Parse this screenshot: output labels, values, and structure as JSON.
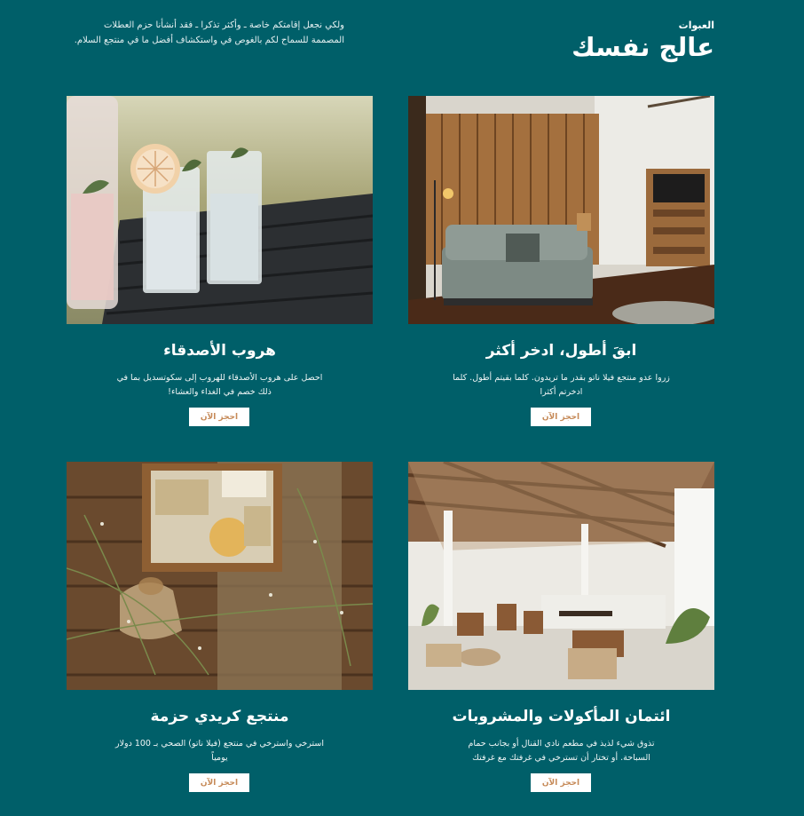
{
  "header": {
    "eyebrow": "العبوات",
    "title": "عالج نفسك",
    "description": "ولكي نجعل إقامتكم خاصة ـ وأكثر تذكرا ـ فقد أنشأنا حزم العطلات المصممة للسماح لكم بالغوص في واستكشاف أفضل ما في منتجع السلام."
  },
  "cards": [
    {
      "title": "ابقَ أطول، ادخر أكثر",
      "description": "زروا عدو منتجع فيلا ناتو بقدر ما تريدون. كلما بقيتم أطول. كلما ادخرتم أكثرا",
      "button": "احجز الآن",
      "image": "living-room-photo"
    },
    {
      "title": "هروب الأصدقاء",
      "description": "احصل على هروب الأصدقاء للهروب إلى سكوتسديل بما في ذلك خصم في الغداء والعشاء!",
      "button": "احجز الآن",
      "image": "drinks-photo"
    },
    {
      "title": "ائتمان المأكولات والمشروبات",
      "description": "تذوق شيء لذيذ في مطعم نادي القنال أو بجانب حمام السباحة. أو تختار أن تسترخي في غرفتك مع غرفتك",
      "button": "احجز الآن",
      "image": "restaurant-photo"
    },
    {
      "title": "منتجع كريدي حزمة",
      "description": "استرخي واسترخي في منتجع (فيلا ناتو) الصحي بـ 100 دولار يومياً",
      "button": "احجز الآن",
      "image": "spa-basket-photo"
    }
  ],
  "colors": {
    "background": "#005f69",
    "button_text": "#c68a58",
    "button_bg": "#ffffff"
  }
}
